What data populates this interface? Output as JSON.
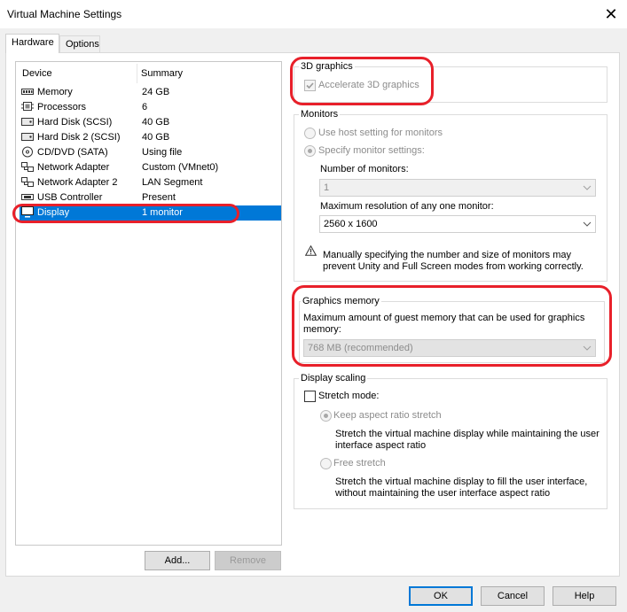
{
  "window": {
    "title": "Virtual Machine Settings"
  },
  "tabs": [
    {
      "label": "Hardware"
    },
    {
      "label": "Options"
    }
  ],
  "device_list": {
    "headers": {
      "device": "Device",
      "summary": "Summary"
    },
    "rows": [
      {
        "device": "Memory",
        "summary": "24 GB",
        "icon": "memory-icon"
      },
      {
        "device": "Processors",
        "summary": "6",
        "icon": "processor-icon"
      },
      {
        "device": "Hard Disk (SCSI)",
        "summary": "40 GB",
        "icon": "hard-disk-icon"
      },
      {
        "device": "Hard Disk 2 (SCSI)",
        "summary": "40 GB",
        "icon": "hard-disk-icon"
      },
      {
        "device": "CD/DVD (SATA)",
        "summary": "Using file",
        "icon": "cd-dvd-icon"
      },
      {
        "device": "Network Adapter",
        "summary": "Custom (VMnet0)",
        "icon": "network-adapter-icon"
      },
      {
        "device": "Network Adapter 2",
        "summary": "LAN Segment",
        "icon": "network-adapter-icon"
      },
      {
        "device": "USB Controller",
        "summary": "Present",
        "icon": "usb-icon"
      },
      {
        "device": "Display",
        "summary": "1 monitor",
        "icon": "display-icon",
        "selected": true
      }
    ],
    "add_label": "Add...",
    "remove_label": "Remove"
  },
  "graphics_3d": {
    "title": "3D graphics",
    "accelerate_label": "Accelerate 3D graphics",
    "accelerate_checked": true
  },
  "monitors": {
    "title": "Monitors",
    "use_host_label": "Use host setting for monitors",
    "specify_label": "Specify monitor settings:",
    "number_label": "Number of monitors:",
    "number_value": "1",
    "resolution_label": "Maximum resolution of any one monitor:",
    "resolution_value": "2560 x 1600",
    "warning_line1": "Manually specifying the number and size of monitors may",
    "warning_line2": "prevent Unity and Full Screen modes from working correctly."
  },
  "graphics_memory": {
    "title": "Graphics memory",
    "desc_line1": "Maximum amount of guest memory that can be used for graphics",
    "desc_line2": "memory:",
    "value": "768 MB (recommended)"
  },
  "display_scaling": {
    "title": "Display scaling",
    "stretch_label": "Stretch mode:",
    "stretch_checked": false,
    "keep_label": "Keep aspect ratio stretch",
    "keep_desc1": "Stretch the virtual machine display while maintaining the user",
    "keep_desc2": "interface aspect ratio",
    "free_label": "Free stretch",
    "free_desc1": "Stretch the virtual machine display to fill the user interface,",
    "free_desc2": "without maintaining the user interface aspect ratio"
  },
  "footer": {
    "ok_label": "OK",
    "cancel_label": "Cancel",
    "help_label": "Help"
  },
  "colors": {
    "selection": "#0078d7",
    "annotation": "#e8202a"
  }
}
